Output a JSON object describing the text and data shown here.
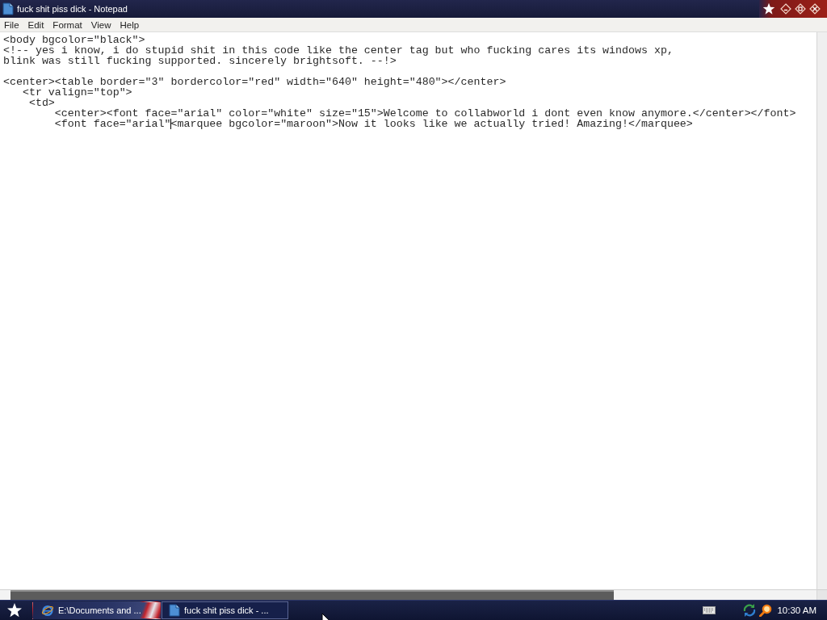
{
  "window": {
    "title": "fuck shit piss dick - Notepad"
  },
  "menu": [
    "File",
    "Edit",
    "Format",
    "View",
    "Help"
  ],
  "editor": {
    "blocks": [
      [
        {
          "text": "<body bgcolor=\"black\">",
          "caret": false
        },
        {
          "text": "<!-- yes i know, i do stupid shit in this code like the center tag but who fucking cares its windows xp,",
          "caret": false
        },
        {
          "text": "blink was still fucking supported. sincerely brightsoft. --!>",
          "caret": false
        }
      ],
      [
        {
          "text": "<center><table border=\"3\" bordercolor=\"red\" width=\"640\" height=\"480\"></center>",
          "caret": false
        },
        {
          "text": "   <tr valign=\"top\">",
          "caret": false
        },
        {
          "text": "    <td>",
          "caret": false
        },
        {
          "text": "        <center><font face=\"arial\" color=\"white\" size=\"15\">Welcome to collabworld i dont even know anymore.</center></font>",
          "caret": false
        },
        {
          "text": "        <font face=\"arial\"",
          "caret": true,
          "text_after_caret": "<marquee bgcolor=\"maroon\">Now it looks like we actually tried! Amazing!</marquee>"
        }
      ]
    ]
  },
  "taskbar": {
    "buttons": [
      {
        "kind": "browser",
        "label": "E:\\Documents and ...",
        "selected": false
      },
      {
        "kind": "notepad",
        "label": "fuck shit piss dick - ...",
        "selected": true
      }
    ],
    "clock": "10:30 AM"
  }
}
